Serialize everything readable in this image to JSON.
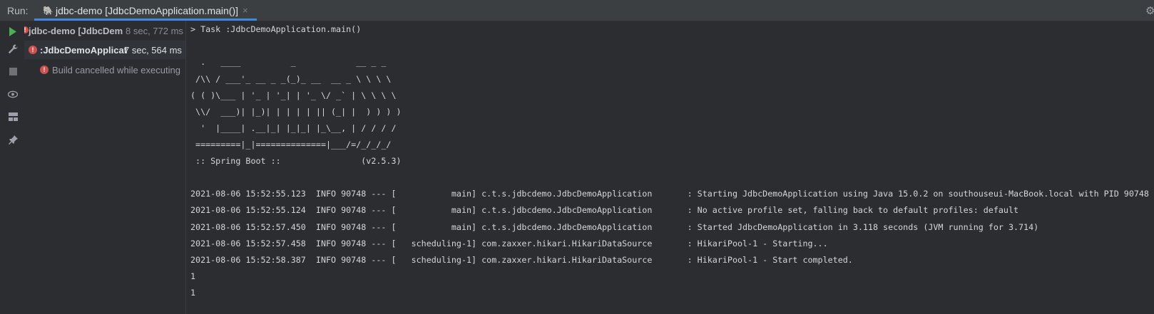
{
  "header": {
    "run_label": "Run:",
    "tab_title": "jdbc-demo [JdbcDemoApplication.main()]",
    "tab_close": "×"
  },
  "toolbar": {
    "icons": [
      "run-icon",
      "wrench-icon",
      "stop-icon",
      "eye-icon",
      "layout-icon",
      "pin-icon"
    ]
  },
  "tree": {
    "root": {
      "label": "jdbc-demo [JdbcDem",
      "time": "8 sec, 772 ms"
    },
    "task": {
      "label": ":JdbcDemoApplicat",
      "time": "7 sec, 564 ms"
    },
    "message": {
      "label": "Build cancelled while executing"
    }
  },
  "console": {
    "lines": [
      "> Task :JdbcDemoApplication.main()",
      "",
      "  .   ____          _            __ _ _",
      " /\\\\ / ___'_ __ _ _(_)_ __  __ _ \\ \\ \\ \\",
      "( ( )\\___ | '_ | '_| | '_ \\/ _` | \\ \\ \\ \\",
      " \\\\/  ___)| |_)| | | | | || (_| |  ) ) ) )",
      "  '  |____| .__|_| |_|_| |_\\__, | / / / /",
      " =========|_|==============|___/=/_/_/_/",
      " :: Spring Boot ::                (v2.5.3)",
      "",
      "2021-08-06 15:52:55.123  INFO 90748 --- [           main] c.t.s.jdbcdemo.JdbcDemoApplication       : Starting JdbcDemoApplication using Java 15.0.2 on southouseui-MacBook.local with PID 90748",
      "2021-08-06 15:52:55.124  INFO 90748 --- [           main] c.t.s.jdbcdemo.JdbcDemoApplication       : No active profile set, falling back to default profiles: default",
      "2021-08-06 15:52:57.450  INFO 90748 --- [           main] c.t.s.jdbcdemo.JdbcDemoApplication       : Started JdbcDemoApplication in 3.118 seconds (JVM running for 3.714)",
      "2021-08-06 15:52:57.458  INFO 90748 --- [   scheduling-1] com.zaxxer.hikari.HikariDataSource       : HikariPool-1 - Starting...",
      "2021-08-06 15:52:58.387  INFO 90748 --- [   scheduling-1] com.zaxxer.hikari.HikariDataSource       : HikariPool-1 - Start completed.",
      "1",
      "1"
    ]
  },
  "colors": {
    "background": "#2b2d30",
    "accent": "#4a88c7",
    "error": "#d05050",
    "run_green": "#4caf50"
  }
}
